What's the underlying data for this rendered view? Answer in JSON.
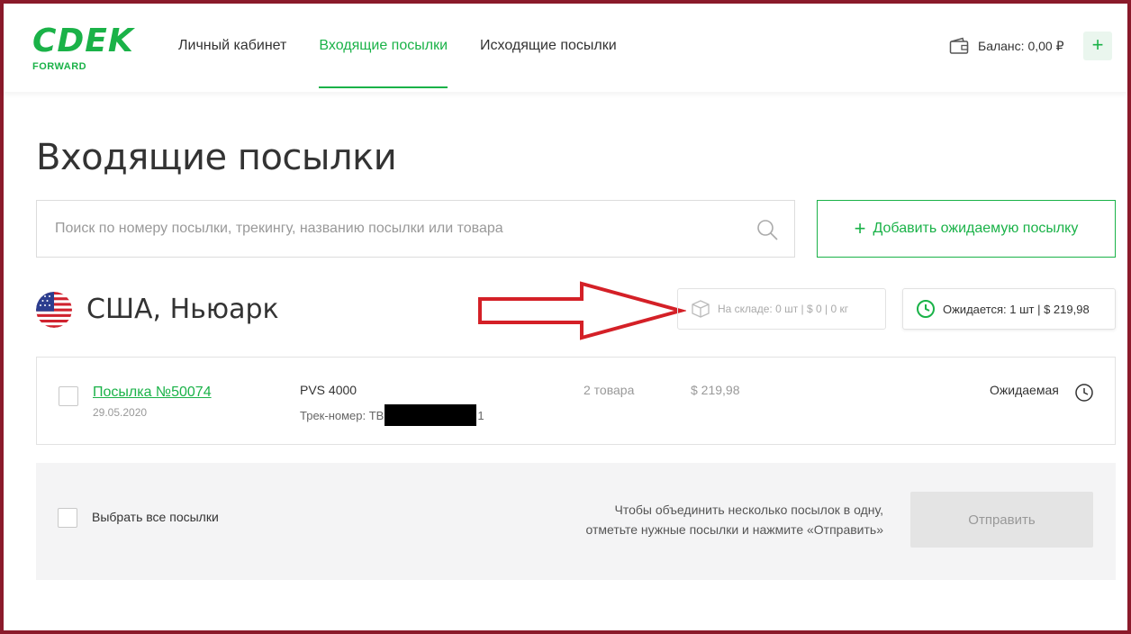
{
  "logo": {
    "main": "CDEK",
    "sub": "FORWARD"
  },
  "nav": {
    "items": [
      {
        "label": "Личный кабинет"
      },
      {
        "label": "Входящие посылки"
      },
      {
        "label": "Исходящие посылки"
      }
    ]
  },
  "header": {
    "balance": "Баланс: 0,00 ₽",
    "plus_label": "+"
  },
  "page": {
    "title": "Входящие посылки"
  },
  "search": {
    "placeholder": "Поиск по номеру посылки, трекингу, названию посылки или товара"
  },
  "add_button": {
    "plus": "+",
    "label": "Добавить ожидаемую посылку"
  },
  "warehouse": {
    "name": "США, Ньюарк",
    "stock": "На складе: 0 шт | $ 0 | 0 кг",
    "expected": "Ожидается: 1 шт | $ 219,98"
  },
  "parcel": {
    "link": "Посылка №50074",
    "date": "29.05.2020",
    "product": "PVS 4000",
    "track_prefix": "Трек-номер: ТВ",
    "track_suffix": "1",
    "items": "2 товара",
    "price": "$ 219,98",
    "status": "Ожидаемая"
  },
  "footer": {
    "select_all": "Выбрать все посылки",
    "hint_line1": "Чтобы объединить несколько посылок в одну,",
    "hint_line2": "отметьте нужные посылки и нажмите «Отправить»",
    "send": "Отправить"
  },
  "colors": {
    "accent": "#1ab248",
    "frame": "#8b1a2b",
    "arrow": "#d42027"
  }
}
